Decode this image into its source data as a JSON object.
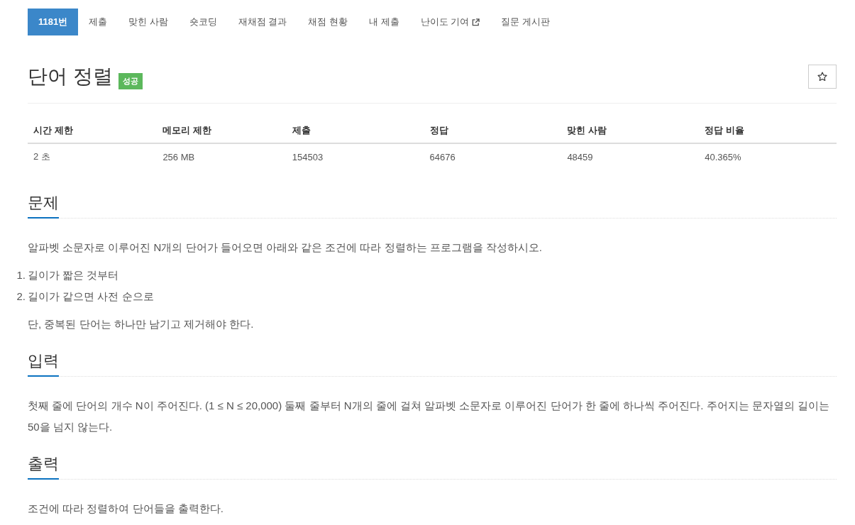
{
  "nav": {
    "tabs": [
      {
        "label": "1181번",
        "selected": true,
        "external": false
      },
      {
        "label": "제출",
        "selected": false,
        "external": false
      },
      {
        "label": "맞힌 사람",
        "selected": false,
        "external": false
      },
      {
        "label": "숏코딩",
        "selected": false,
        "external": false
      },
      {
        "label": "재채점 결과",
        "selected": false,
        "external": false
      },
      {
        "label": "채점 현황",
        "selected": false,
        "external": false
      },
      {
        "label": "내 제출",
        "selected": false,
        "external": false
      },
      {
        "label": "난이도 기여",
        "selected": false,
        "external": true
      },
      {
        "label": "질문 게시판",
        "selected": false,
        "external": false
      }
    ]
  },
  "problem": {
    "title": "단어 정렬",
    "badge": {
      "label": "성공",
      "kind": "success"
    },
    "favorite": {
      "starred": false
    }
  },
  "info_table": {
    "columns": [
      "시간 제한",
      "메모리 제한",
      "제출",
      "정답",
      "맞힌 사람",
      "정답 비율"
    ],
    "rows": [
      [
        "2 초",
        "256 MB",
        "154503",
        "64676",
        "48459",
        "40.365%"
      ]
    ]
  },
  "sections": [
    {
      "heading": "문제",
      "blocks": [
        {
          "kind": "paragraph",
          "text": "알파벳 소문자로 이루어진 N개의 단어가 들어오면 아래와 같은 조건에 따라 정렬하는 프로그램을 작성하시오."
        },
        {
          "kind": "list",
          "items": [
            {
              "number": "1.",
              "text": "길이가 짧은 것부터"
            },
            {
              "number": "2.",
              "text": "길이가 같으면 사전 순으로"
            }
          ]
        },
        {
          "kind": "paragraph",
          "text": "단, 중복된 단어는 하나만 남기고 제거해야 한다."
        }
      ]
    },
    {
      "heading": "입력",
      "blocks": [
        {
          "kind": "paragraph",
          "text": "첫째 줄에 단어의 개수 N이 주어진다. (1 ≤ N ≤ 20,000) 둘째 줄부터 N개의 줄에 걸쳐 알파벳 소문자로 이루어진 단어가 한 줄에 하나씩 주어진다. 주어지는 문자열의 길이는 50을 넘지 않는다."
        }
      ]
    },
    {
      "heading": "출력",
      "blocks": [
        {
          "kind": "paragraph",
          "text": "조건에 따라 정렬하여 단어들을 출력한다."
        }
      ]
    }
  ]
}
